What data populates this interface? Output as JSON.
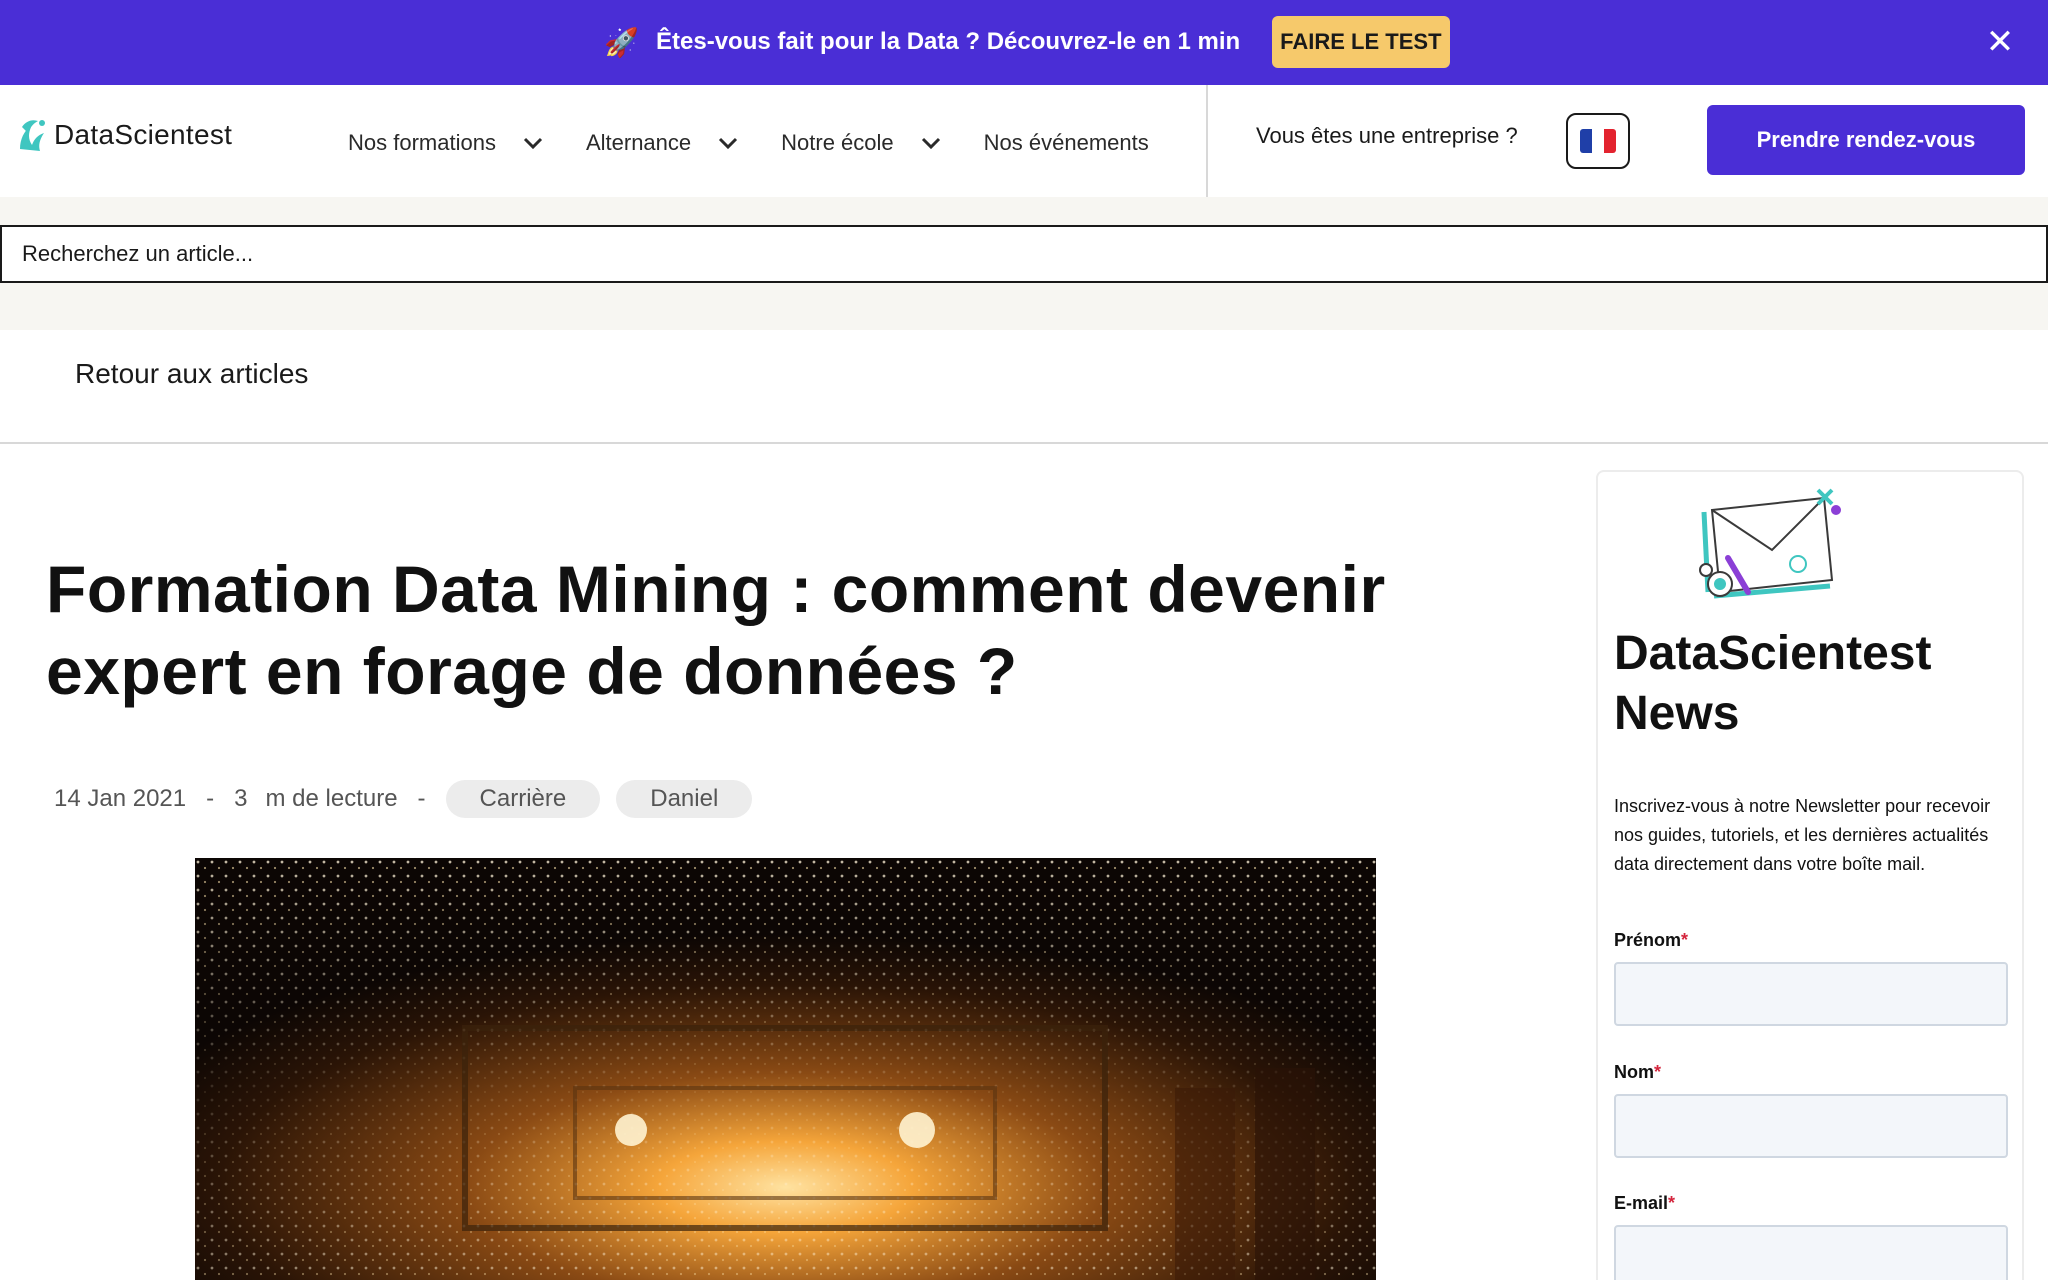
{
  "promo": {
    "icon": "rocket-icon",
    "text": "Êtes-vous fait pour la Data ? Découvrez-le en 1 min",
    "button": "FAIRE LE TEST",
    "close_icon": "close-icon"
  },
  "header": {
    "logo_text": "DataScientest",
    "nav": [
      {
        "label": "Nos formations",
        "has_dropdown": true
      },
      {
        "label": "Alternance",
        "has_dropdown": true
      },
      {
        "label": "Notre école",
        "has_dropdown": true
      },
      {
        "label": "Nos événements",
        "has_dropdown": false
      }
    ],
    "enterprise": "Vous êtes une entreprise ?",
    "language_icon": "france-flag-icon",
    "cta": "Prendre rendez-vous"
  },
  "search": {
    "placeholder": "Recherchez un article..."
  },
  "back": {
    "label": "Retour aux articles"
  },
  "article": {
    "title": "Formation Data Mining : comment devenir expert en forage de données ?",
    "date": "14 Jan 2021",
    "separator": "-",
    "read_time": "3",
    "read_label": "m de lecture",
    "tags": [
      "Carrière",
      "Daniel"
    ]
  },
  "newsletter": {
    "title": "DataScientest News",
    "description": "Inscrivez-vous à notre Newsletter pour recevoir nos guides, tutoriels, et les dernières actualités data directement dans votre boîte mail.",
    "fields": [
      {
        "label": "Prénom",
        "required_mark": "*"
      },
      {
        "label": "Nom",
        "required_mark": "*"
      },
      {
        "label": "E-mail",
        "required_mark": "*"
      }
    ]
  },
  "colors": {
    "brand": "#4a2ed6",
    "promo_button": "#f6c96b",
    "logo_accent": "#3fc6c0",
    "required": "#d4243c"
  }
}
